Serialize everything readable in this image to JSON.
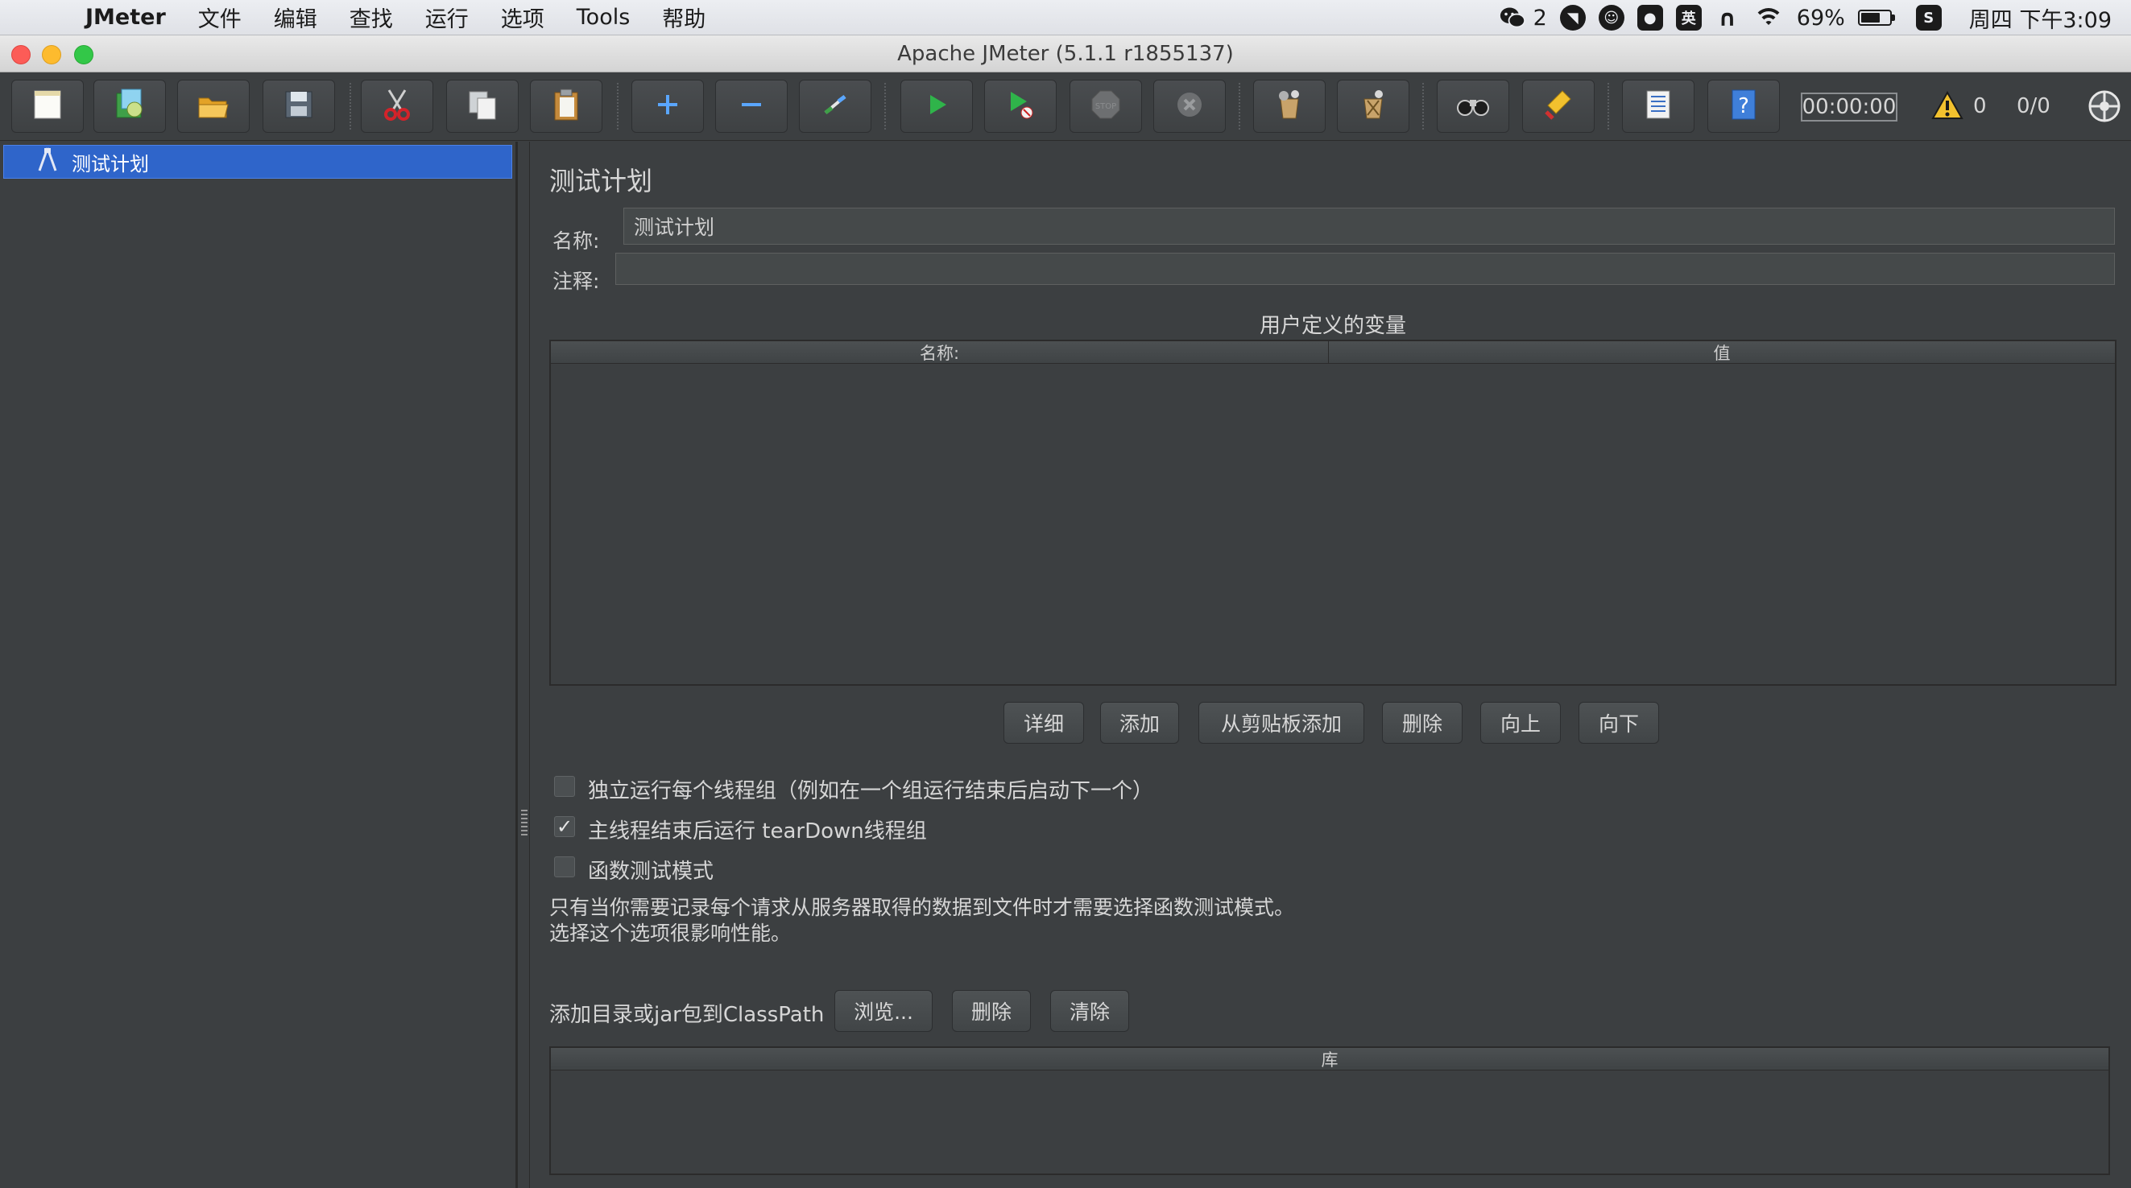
{
  "menubar": {
    "app_name": "JMeter",
    "items": [
      "文件",
      "编辑",
      "查找",
      "运行",
      "选项",
      "Tools",
      "帮助"
    ],
    "wechat_count": "2",
    "input_method": "英",
    "battery_percent": "69%",
    "battery_level": 0.69,
    "clock": "周四 下午3:09"
  },
  "window": {
    "title": "Apache JMeter (5.1.1 r1855137)"
  },
  "toolbar": {
    "timer": "00:00:00",
    "warning_count": "0",
    "thread_count": "0/0",
    "buttons": [
      "new-icon",
      "templates-icon",
      "open-icon",
      "save-icon",
      "cut-icon",
      "copy-icon",
      "paste-icon",
      "expand-icon",
      "collapse-icon",
      "toggle-icon",
      "start-icon",
      "start-no-pause-icon",
      "stop-icon",
      "shutdown-icon",
      "clear-icon",
      "clear-all-icon",
      "search-icon",
      "reset-search-icon",
      "function-helper-icon",
      "help-icon"
    ]
  },
  "tree": {
    "selected_item": "测试计划"
  },
  "test_plan": {
    "title": "测试计划",
    "name_label": "名称:",
    "name_value": "测试计划",
    "comment_label": "注释:",
    "comment_value": "",
    "variables_title": "用户定义的变量",
    "variables_columns": [
      "名称:",
      "值"
    ],
    "buttons": [
      "详细",
      "添加",
      "从剪贴板添加",
      "删除",
      "向上",
      "向下"
    ],
    "options": [
      {
        "label": "独立运行每个线程组（例如在一个组运行结束后启动下一个）",
        "checked": false
      },
      {
        "label": "主线程结束后运行 tearDown线程组",
        "checked": true
      },
      {
        "label": "函数测试模式",
        "checked": false
      }
    ],
    "functional_note_line1": "只有当你需要记录每个请求从服务器取得的数据到文件时才需要选择函数测试模式。",
    "functional_note_line2": "选择这个选项很影响性能。",
    "classpath_label": "添加目录或jar包到ClassPath",
    "classpath_buttons": [
      "浏览...",
      "删除",
      "清除"
    ],
    "library_column": "库"
  }
}
